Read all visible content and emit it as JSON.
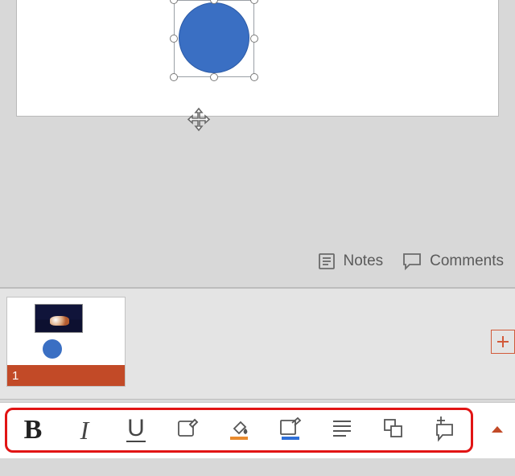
{
  "meta": {
    "notes_label": "Notes",
    "comments_label": "Comments"
  },
  "thumb": {
    "index": "1"
  },
  "shape": {
    "fill": "#3a6fc3"
  },
  "toolbar": {
    "bold": "B",
    "italic": "I",
    "underline": "U",
    "icons": {
      "bold": "bold-icon",
      "italic": "italic-icon",
      "underline": "underline-icon",
      "format_painter": "format-painter-icon",
      "fill_color": "fill-color-icon",
      "outline_color": "outline-color-icon",
      "paragraph": "paragraph-icon",
      "arrange": "arrange-icon",
      "new_text_box": "new-text-box-icon",
      "expand": "expand-caret-icon"
    },
    "colors": {
      "fill_swatch": "#e98b2e",
      "outline_swatch": "#2e6fd8"
    }
  }
}
